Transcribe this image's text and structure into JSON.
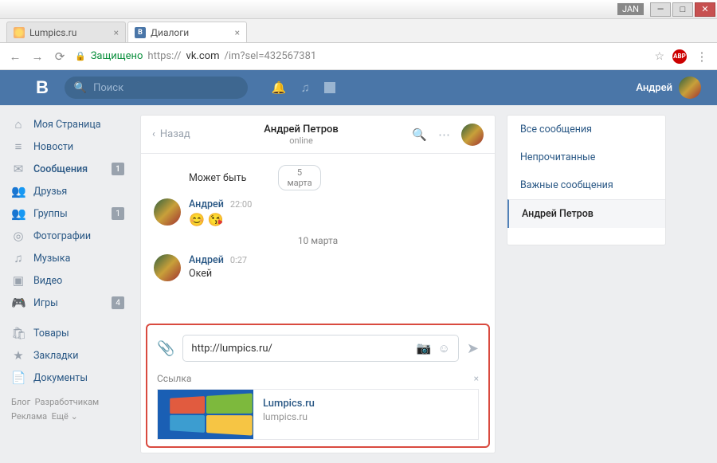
{
  "window": {
    "user": "JAN"
  },
  "tabs": [
    {
      "title": "Lumpics.ru",
      "active": false
    },
    {
      "title": "Диалоги",
      "active": true
    }
  ],
  "address": {
    "secure": "Защищено",
    "host": "https://",
    "domain": "vk.com",
    "path": "/im?sel=432567381"
  },
  "header": {
    "search_placeholder": "Поиск",
    "username": "Андрей"
  },
  "sidebar": {
    "items": [
      {
        "icon": "⌂",
        "label": "Моя Страница"
      },
      {
        "icon": "≡",
        "label": "Новости"
      },
      {
        "icon": "✉",
        "label": "Сообщения",
        "badge": "1",
        "active": true
      },
      {
        "icon": "👥",
        "label": "Друзья"
      },
      {
        "icon": "👥",
        "label": "Группы",
        "badge": "1"
      },
      {
        "icon": "◎",
        "label": "Фотографии"
      },
      {
        "icon": "♫",
        "label": "Музыка"
      },
      {
        "icon": "▶",
        "label": "Видео"
      },
      {
        "icon": "🎮",
        "label": "Игры",
        "badge": "4"
      }
    ],
    "items2": [
      {
        "icon": "🛍",
        "label": "Товары"
      },
      {
        "icon": "★",
        "label": "Закладки"
      },
      {
        "icon": "📄",
        "label": "Документы"
      }
    ],
    "footer": {
      "l1": "Блог",
      "l2": "Разработчикам",
      "l3": "Реклама",
      "l4": "Ещё ⌄"
    }
  },
  "chat": {
    "back": "Назад",
    "title": "Андрей Петров",
    "status": "online",
    "prev_msg": "Может быть",
    "date1": "5 марта",
    "m1": {
      "sender": "Андрей",
      "time": "22:00",
      "body": "😊 😘"
    },
    "date2": "10 марта",
    "m2": {
      "sender": "Андрей",
      "time": "0:27",
      "body": "Окей"
    },
    "input_value": "http://lumpics.ru/",
    "link_label": "Ссылка",
    "link": {
      "title": "Lumpics.ru",
      "url": "lumpics.ru"
    }
  },
  "filters": {
    "all": "Все сообщения",
    "unread": "Непрочитанные",
    "important": "Важные сообщения",
    "current": "Андрей Петров"
  }
}
